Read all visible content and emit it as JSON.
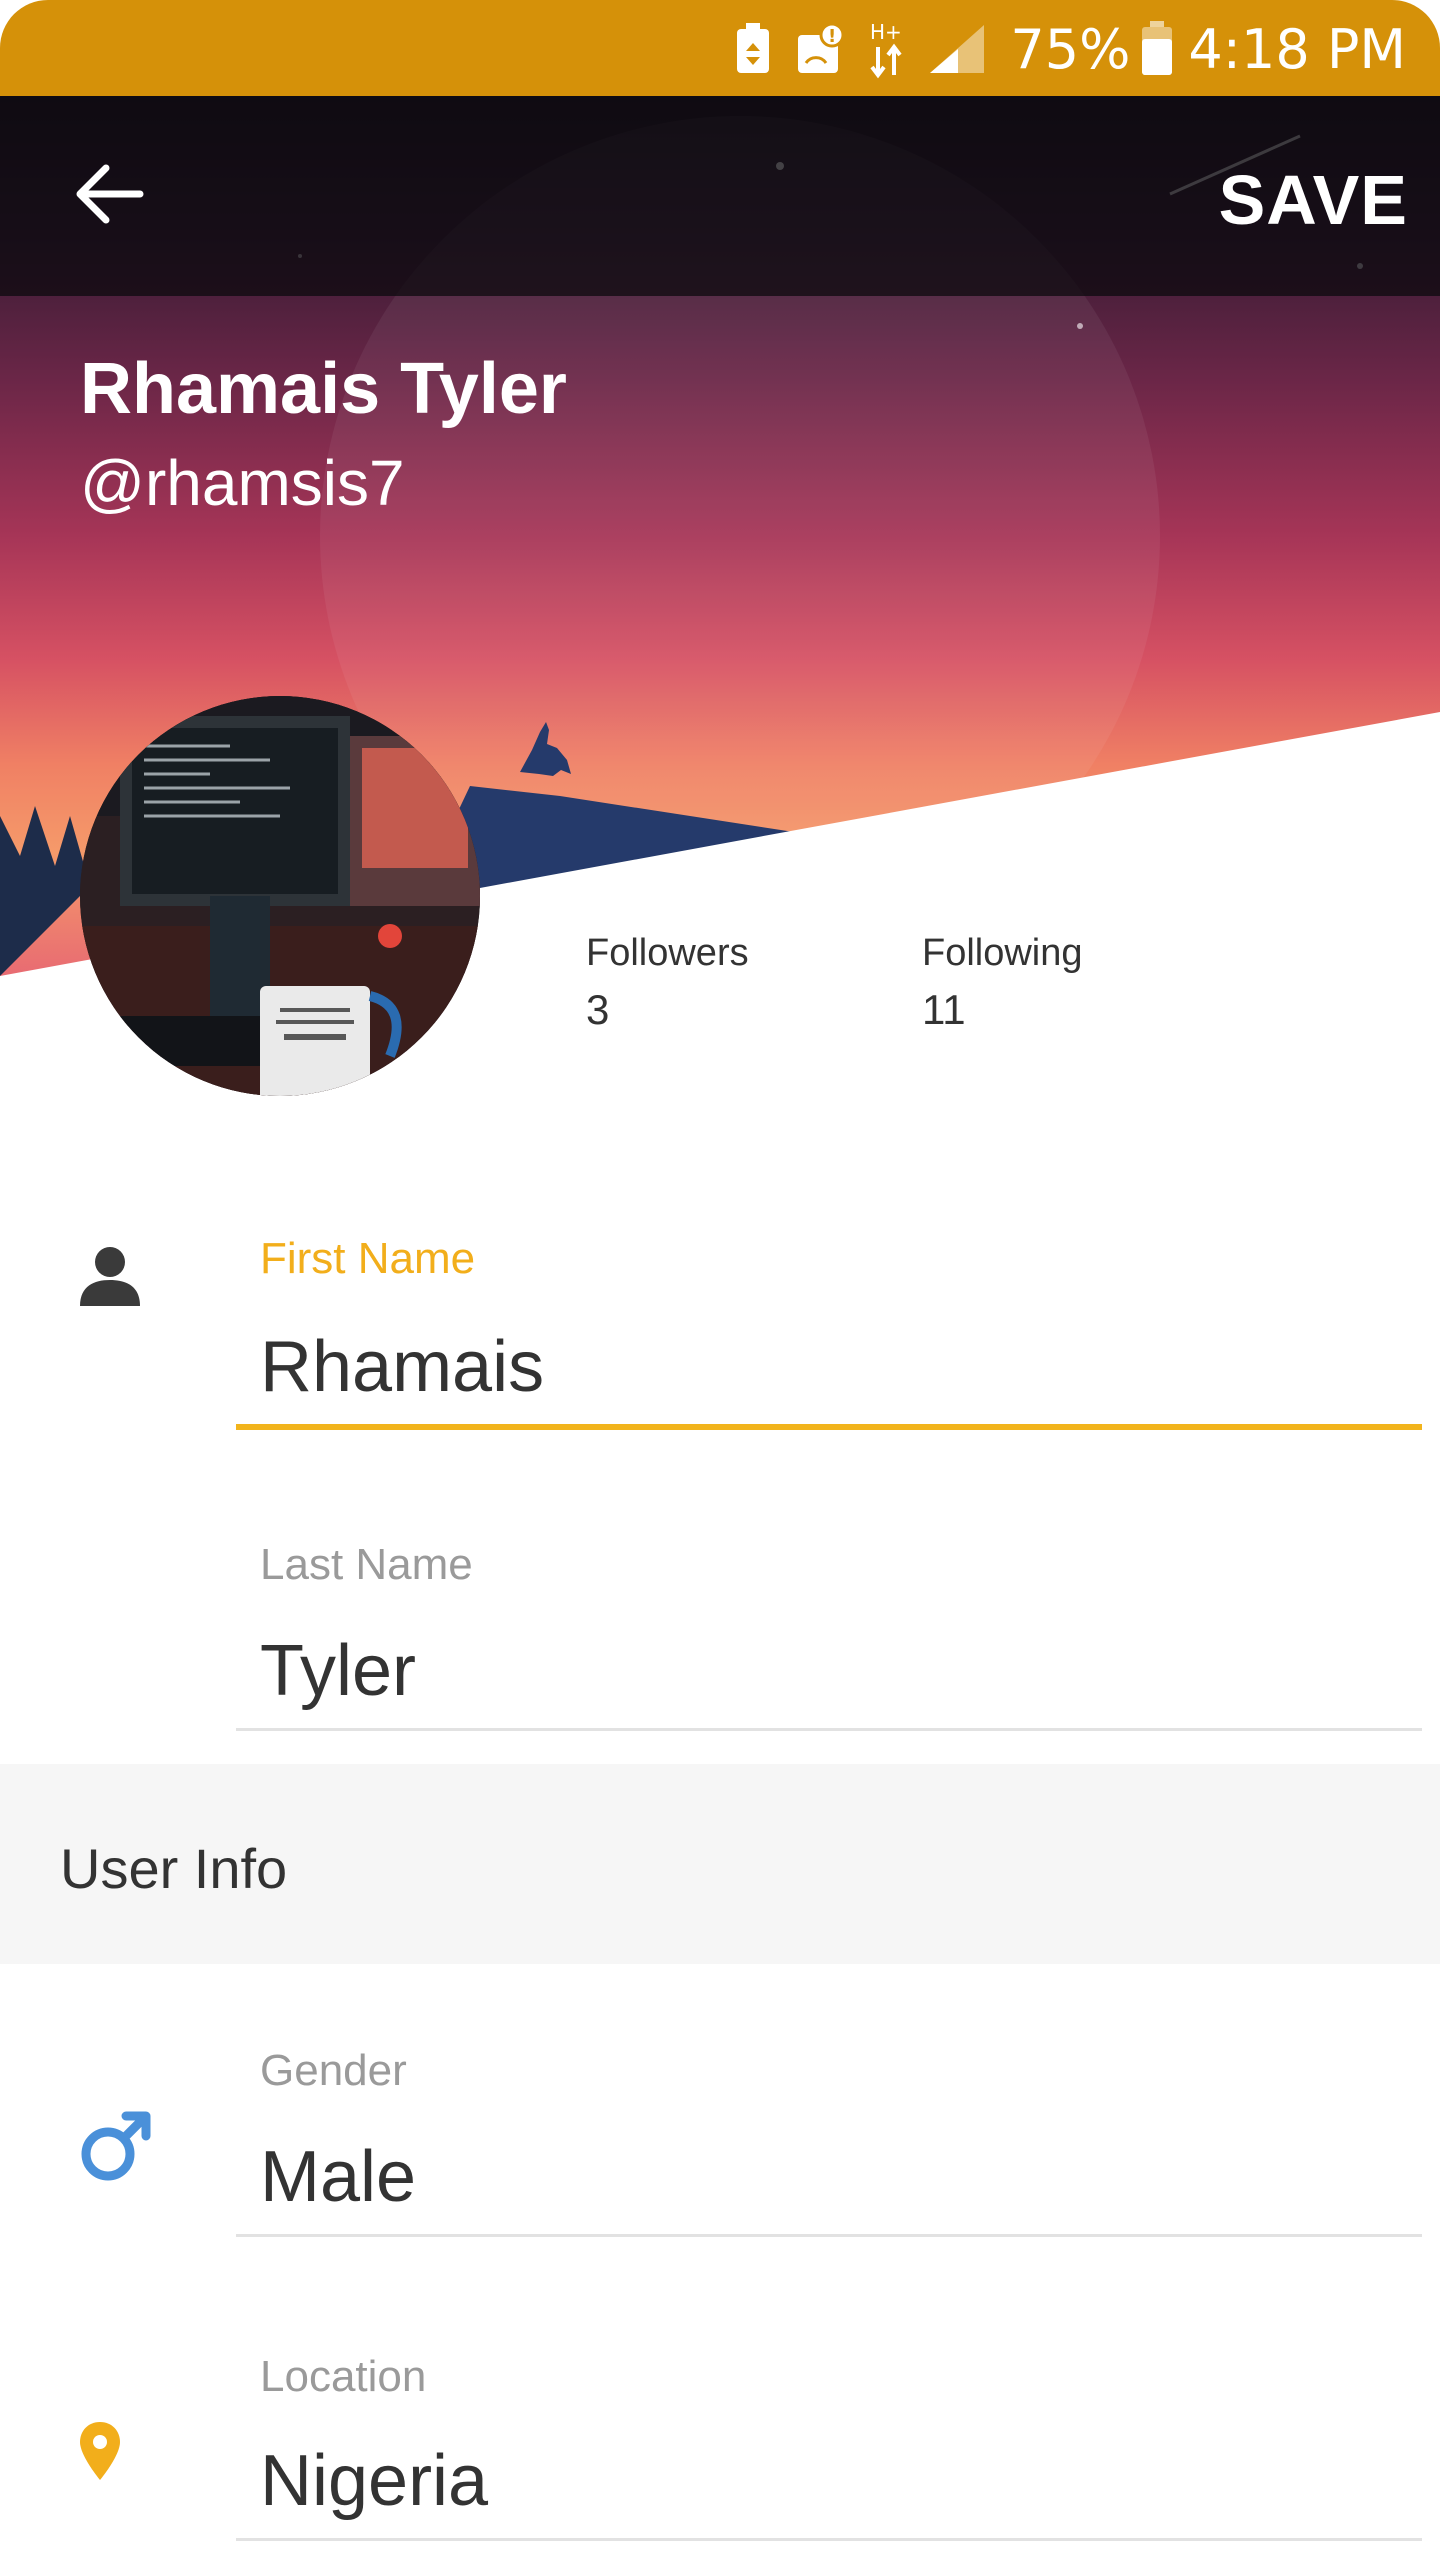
{
  "status_bar": {
    "battery": "75%",
    "time": "4:18 PM",
    "network": "H+"
  },
  "toolbar": {
    "back_icon": "arrow-left-icon",
    "save_label": "SAVE"
  },
  "profile": {
    "name": "Rhamais Tyler",
    "handle": "@rhamsis7",
    "followers_label": "Followers",
    "followers_count": "3",
    "following_label": "Following",
    "following_count": "11"
  },
  "form": {
    "first_name": {
      "label": "First Name",
      "value": "Rhamais",
      "icon": "person-icon"
    },
    "last_name": {
      "label": "Last Name",
      "value": "Tyler"
    },
    "section_title": "User Info",
    "gender": {
      "label": "Gender",
      "value": "Male",
      "icon": "male-icon"
    },
    "location": {
      "label": "Location",
      "value": "Nigeria",
      "icon": "location-pin-icon"
    }
  },
  "colors": {
    "status_bar": "#d59109",
    "accent": "#f2b41c",
    "male_icon": "#4a90d9",
    "location_icon": "#f2ae1b"
  }
}
